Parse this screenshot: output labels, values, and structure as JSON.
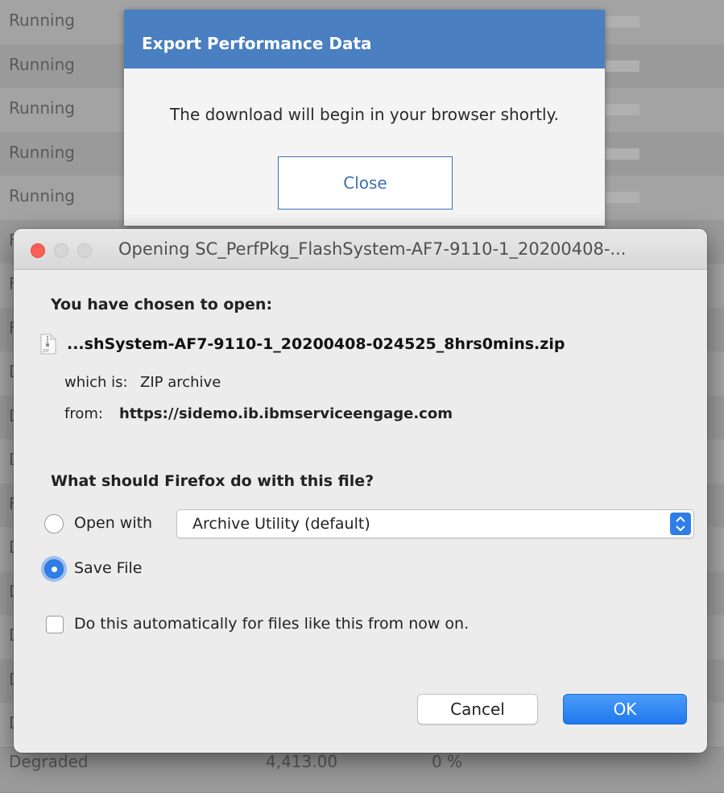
{
  "background": {
    "rows": [
      {
        "status": "Running"
      },
      {
        "status": "Running"
      },
      {
        "status": "Running"
      },
      {
        "status": "Running"
      },
      {
        "status": "Running"
      },
      {
        "status": "F"
      },
      {
        "status": "F"
      },
      {
        "status": "F"
      },
      {
        "status": "D"
      },
      {
        "status": "D"
      },
      {
        "status": "D"
      },
      {
        "status": "F"
      },
      {
        "status": "D"
      },
      {
        "status": "D"
      },
      {
        "status": "D"
      },
      {
        "status": "D"
      },
      {
        "status": "D"
      },
      {
        "status": "Degraded",
        "value": "4,413.00",
        "percent": "0 %"
      }
    ]
  },
  "export_modal": {
    "title": "Export Performance Data",
    "message": "The download will begin in your browser shortly.",
    "close_label": "Close",
    "header_color": "#4a7fc1"
  },
  "firefox_dialog": {
    "window_title": "Opening SC_PerfPkg_FlashSystem-AF7-9110-1_20200408-...",
    "chosen_heading": "You have chosen to open:",
    "file_name": "...shSystem-AF7-9110-1_20200408-024525_8hrs0mins.zip",
    "file_icon": "zip-file-icon",
    "which_is_label": "which is:",
    "which_is_value": "ZIP archive",
    "from_label": "from:",
    "from_value": "https://sidemo.ib.ibmserviceengage.com",
    "question": "What should Firefox do with this file?",
    "open_with_label": "Open with",
    "open_with_app": "Archive Utility (default)",
    "save_file_label": "Save File",
    "selected_option": "save_file",
    "auto_label": "Do this automatically for files like this from now on.",
    "auto_checked": false,
    "cancel_label": "Cancel",
    "ok_label": "OK",
    "accent_color": "#2f7ee8"
  }
}
